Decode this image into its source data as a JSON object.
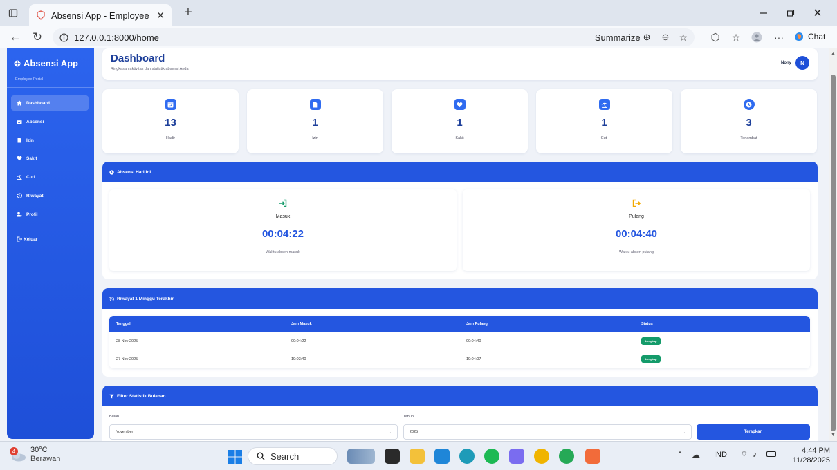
{
  "browser": {
    "tab_title": "Absensi App - Employee Portal",
    "url": "127.0.0.1:8000/home",
    "summarize_label": "Summarize",
    "chat_label": "Chat"
  },
  "sidebar": {
    "brand": "Absensi App",
    "brand_sub": "Employee Portal",
    "items": [
      {
        "label": "Dashboard",
        "icon": "home-icon"
      },
      {
        "label": "Absensi",
        "icon": "calendar-check-icon"
      },
      {
        "label": "Izin",
        "icon": "file-icon"
      },
      {
        "label": "Sakit",
        "icon": "heartbeat-icon"
      },
      {
        "label": "Cuti",
        "icon": "umbrella-beach-icon"
      },
      {
        "label": "Riwayat",
        "icon": "history-icon"
      },
      {
        "label": "Profil",
        "icon": "user-cog-icon"
      },
      {
        "label": "Keluar",
        "icon": "sign-out-icon"
      }
    ]
  },
  "header": {
    "title": "Dashboard",
    "subtitle": "Ringkasan aktivitas dan statistik absensi Anda",
    "user_name": "Nony",
    "avatar_initial": "N"
  },
  "stats": [
    {
      "value": "13",
      "label": "Hadir",
      "icon": "calendar-check-icon"
    },
    {
      "value": "1",
      "label": "Izin",
      "icon": "file-icon"
    },
    {
      "value": "1",
      "label": "Sakit",
      "icon": "heartbeat-icon"
    },
    {
      "value": "1",
      "label": "Cuti",
      "icon": "umbrella-beach-icon"
    },
    {
      "value": "3",
      "label": "Terlambat",
      "icon": "clock-icon"
    }
  ],
  "today": {
    "title": "Absensi Hari Ini",
    "masuk_label": "Masuk",
    "masuk_time": "00:04:22",
    "masuk_note": "Waktu absen masuk",
    "pulang_label": "Pulang",
    "pulang_time": "00:04:40",
    "pulang_note": "Waktu absen pulang"
  },
  "history": {
    "title": "Riwayat 1 Minggu Terakhir",
    "columns": [
      "Tanggal",
      "Jam Masuk",
      "Jam Pulang",
      "Status"
    ],
    "rows": [
      {
        "tanggal": "28 Nov 2025",
        "masuk": "00:04:22",
        "pulang": "00:04:40",
        "status": "Lengkap"
      },
      {
        "tanggal": "27 Nov 2025",
        "masuk": "19:03:40",
        "pulang": "19:04:07",
        "status": "Lengkap"
      }
    ]
  },
  "filter": {
    "title": "Filter Statistik Bulanan",
    "bulan_label": "Bulan",
    "bulan_value": "November",
    "tahun_label": "Tahun",
    "tahun_value": "2025",
    "apply_label": "Terapkan"
  },
  "taskbar": {
    "weather_temp": "30°C",
    "weather_desc": "Berawan",
    "weather_badge": "4",
    "search_label": "Search",
    "lang": "IND",
    "time": "4:44 PM",
    "date": "11/28/2025"
  },
  "colors": {
    "primary": "#2456e0",
    "sidebar": "#1e4fd8",
    "success": "#149b6a",
    "pulang_icon": "#f2a900",
    "masuk_icon": "#149b6a"
  }
}
